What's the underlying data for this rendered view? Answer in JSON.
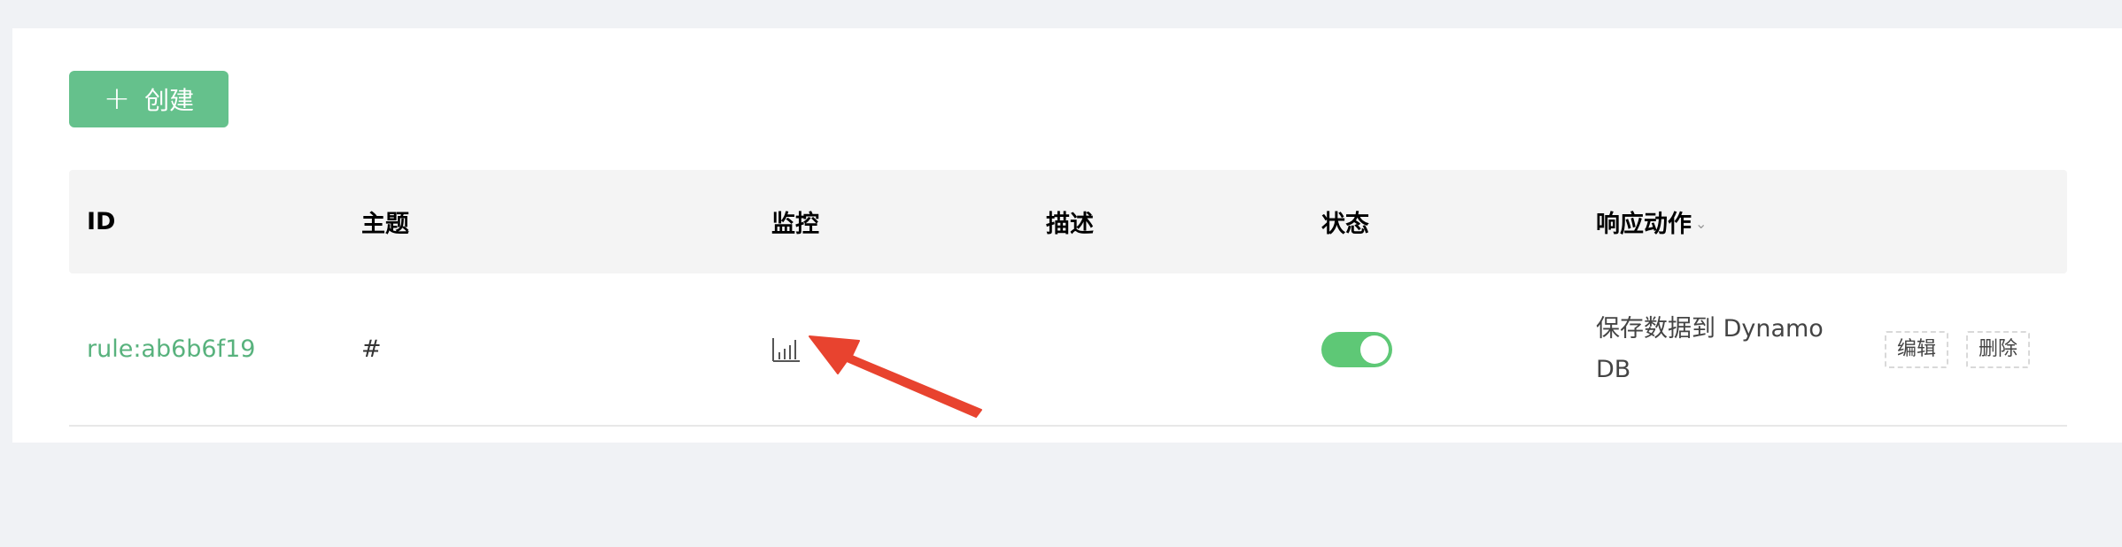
{
  "toolbar": {
    "create_label": "创建",
    "create_icon": "plus-icon"
  },
  "table": {
    "columns": [
      {
        "key": "id",
        "label": "ID"
      },
      {
        "key": "topic",
        "label": "主题"
      },
      {
        "key": "monitor",
        "label": "监控"
      },
      {
        "key": "description",
        "label": "描述"
      },
      {
        "key": "status",
        "label": "状态"
      },
      {
        "key": "actions",
        "label": "响应动作"
      }
    ],
    "rows": [
      {
        "id": "rule:ab6b6f19",
        "topic": "#",
        "monitor_icon": "bar-chart-icon",
        "description": "",
        "status_enabled": true,
        "action_text": "保存数据到 Dynamo DB",
        "edit_label": "编辑",
        "delete_label": "删除"
      }
    ]
  },
  "colors": {
    "primary": "#65c18c",
    "link": "#58b27d",
    "switch_on": "#5ec876",
    "annotation": "#e8432f"
  }
}
